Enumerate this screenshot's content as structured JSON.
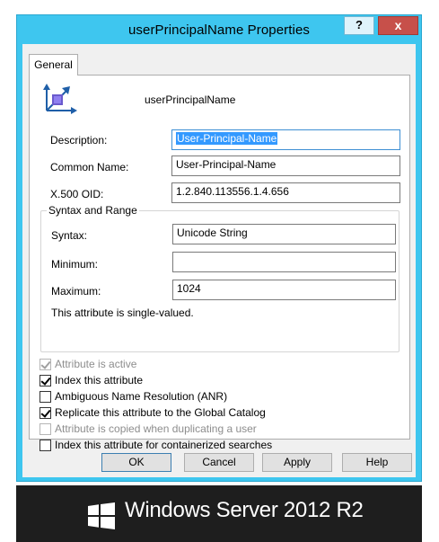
{
  "dialog": {
    "title": "userPrincipalName Properties",
    "help_label": "?",
    "close_label": "x",
    "tab": "General",
    "attribute_name": "userPrincipalName"
  },
  "fields": {
    "description": {
      "label": "Description:",
      "value": "User-Principal-Name"
    },
    "common_name": {
      "label": "Common Name:",
      "value": "User-Principal-Name"
    },
    "oid": {
      "label": "X.500 OID:",
      "value": "1.2.840.113556.1.4.656"
    }
  },
  "syntax_range": {
    "title": "Syntax and Range",
    "syntax": {
      "label": "Syntax:",
      "value": "Unicode String"
    },
    "minimum": {
      "label": "Minimum:",
      "value": ""
    },
    "maximum": {
      "label": "Maximum:",
      "value": "1024"
    },
    "note": "This attribute is single-valued."
  },
  "checkboxes": [
    {
      "label": "Attribute is active",
      "checked": true,
      "disabled": true
    },
    {
      "label": "Index this attribute",
      "checked": true,
      "disabled": false
    },
    {
      "label": "Ambiguous Name Resolution (ANR)",
      "checked": false,
      "disabled": false
    },
    {
      "label": "Replicate this attribute to the Global Catalog",
      "checked": true,
      "disabled": false
    },
    {
      "label": "Attribute is copied when duplicating a user",
      "checked": false,
      "disabled": true
    },
    {
      "label": "Index this attribute for containerized searches",
      "checked": false,
      "disabled": false
    }
  ],
  "buttons": {
    "ok": "OK",
    "cancel": "Cancel",
    "apply": "Apply",
    "help": "Help"
  },
  "branding": {
    "text": "Windows Server 2012 R2"
  },
  "colors": {
    "titlebar": "#3ec6ef",
    "close_button": "#c7504a",
    "selection": "#3399ff",
    "branding_bg": "#1e1e1e"
  },
  "icons": {
    "attribute": "attribute-icon",
    "windows": "windows-logo-icon"
  }
}
